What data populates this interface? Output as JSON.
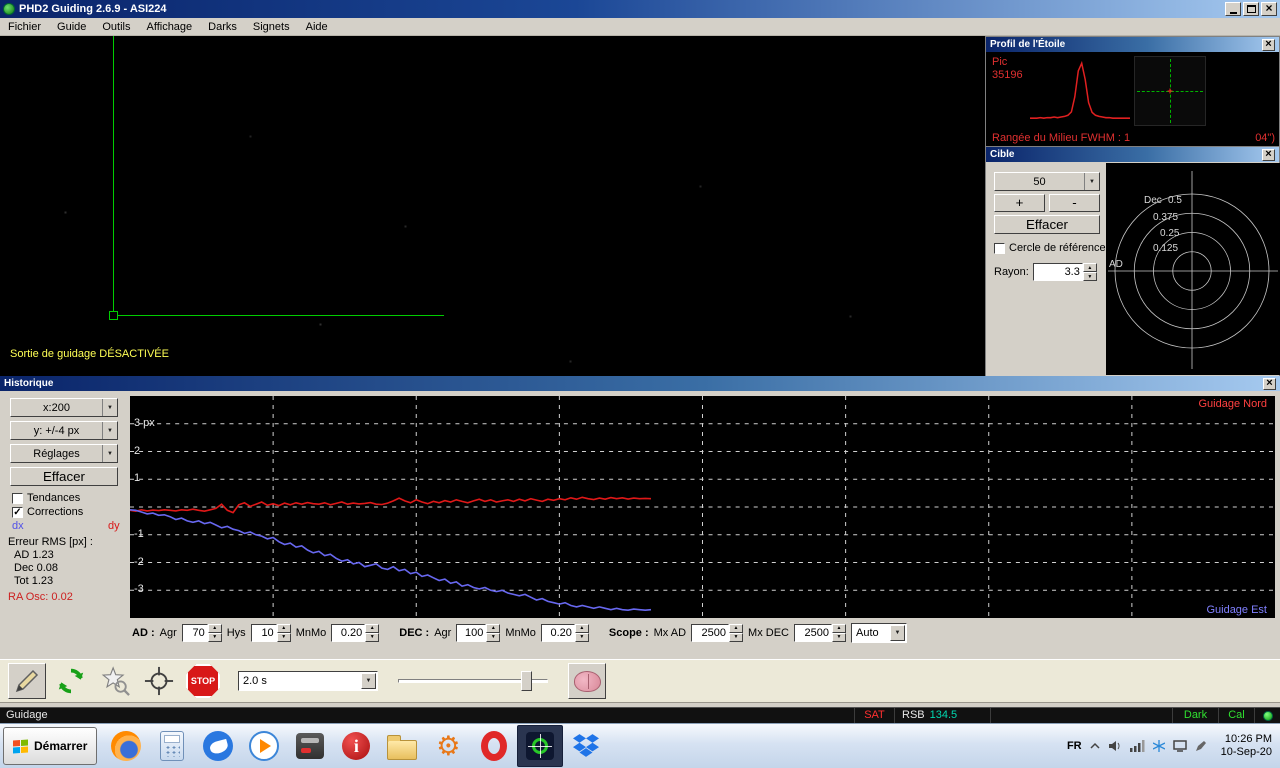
{
  "window": {
    "title": "PHD2 Guiding 2.6.9 - ASI224",
    "menus": [
      "Fichier",
      "Guide",
      "Outils",
      "Affichage",
      "Darks",
      "Signets",
      "Aide"
    ]
  },
  "camera": {
    "overlay_text": "Sortie de guidage DÉSACTIVÉE"
  },
  "star_profile": {
    "title": "Profil de l'Étoile",
    "peak_label": "Pic",
    "peak_value": "35196",
    "fwhm_left": "Rangée du Milieu FWHM : 1",
    "fwhm_right": "04\")"
  },
  "target": {
    "title": "Cible",
    "zoom_value": "50",
    "plus_label": "+",
    "minus_label": "-",
    "clear_label": "Effacer",
    "ref_circle_label": "Cercle de référence",
    "radius_label": "Rayon:",
    "radius_value": "3.3",
    "dec_axis_label": "Dec",
    "ad_axis_label": "AD",
    "ring_labels": [
      "0.5",
      "0.375",
      "0.25",
      "0.125"
    ]
  },
  "history": {
    "title": "Historique",
    "x_scale": "x:200",
    "y_scale": "y: +/-4 px",
    "settings_label": "Réglages",
    "clear_label": "Effacer",
    "trends_label": "Tendances",
    "corrections_label": "Corrections",
    "dx_label": "dx",
    "dy_label": "dy",
    "rms_title": "Erreur RMS [px] :",
    "rms_ad": "AD  1.23",
    "rms_dec": "Dec 0.08",
    "rms_tot": "Tot  1.23",
    "ra_osc": "RA Osc: 0.02",
    "legend_north": "Guidage Nord",
    "legend_east": "Guidage Est",
    "controls": {
      "ad_label": "AD :",
      "ad_agr_label": "Agr",
      "ad_agr_value": "70",
      "ad_hys_label": "Hys",
      "ad_hys_value": "10",
      "ad_mnmo_label": "MnMo",
      "ad_mnmo_value": "0.20",
      "dec_label": "DEC :",
      "dec_agr_label": "Agr",
      "dec_agr_value": "100",
      "dec_mnmo_label": "MnMo",
      "dec_mnmo_value": "0.20",
      "scope_label": "Scope :",
      "mx_ad_label": "Mx AD",
      "mx_ad_value": "2500",
      "mx_dec_label": "Mx DEC",
      "mx_dec_value": "2500",
      "dec_mode_value": "Auto"
    }
  },
  "chart_data": [
    {
      "id": "history-graph",
      "type": "line",
      "title": "Historique",
      "ylabel": "px",
      "ylim": [
        -4,
        4
      ],
      "x_capacity": 200,
      "x_visible": 92,
      "grid": true,
      "y_ticks": [
        {
          "v": 3,
          "label": "3 px"
        },
        {
          "v": 2,
          "label": "2"
        },
        {
          "v": 1,
          "label": "1"
        },
        {
          "v": -1,
          "label": "-1"
        },
        {
          "v": -2,
          "label": "-2"
        },
        {
          "v": -3,
          "label": "-3"
        }
      ],
      "legend": [
        {
          "label": "Guidage Nord",
          "color": "#ff4040",
          "position": "top-right"
        },
        {
          "label": "Guidage Est",
          "color": "#8080ff",
          "position": "bottom-right"
        }
      ],
      "series": [
        {
          "name": "dy",
          "color": "#e01818",
          "values": [
            -0.12,
            -0.15,
            -0.1,
            -0.14,
            -0.11,
            -0.13,
            -0.1,
            -0.12,
            -0.14,
            -0.1,
            -0.12,
            -0.08,
            -0.12,
            -0.15,
            -0.1,
            -0.05,
            0.1,
            -0.12,
            -0.2,
            0.08,
            0.15,
            0.02,
            0.1,
            0.18,
            0.06,
            0.12,
            0.05,
            0.14,
            0.08,
            0.15,
            0.1,
            0.16,
            0.12,
            0.1,
            0.15,
            0.08,
            0.13,
            0.18,
            0.1,
            0.14,
            0.11,
            0.13,
            0.16,
            0.1,
            0.09,
            0.14,
            0.22,
            0.32,
            0.22,
            0.15,
            0.26,
            0.18,
            0.12,
            0.2,
            0.15,
            0.23,
            0.18,
            0.26,
            0.2,
            0.15,
            0.22,
            0.28,
            0.2,
            0.26,
            0.18,
            0.22,
            0.26,
            0.2,
            0.28,
            0.22,
            0.3,
            0.25,
            0.2,
            0.28,
            0.24,
            0.3,
            0.26,
            0.33,
            0.28,
            0.35,
            0.3,
            0.27,
            0.32,
            0.28,
            0.34,
            0.3,
            0.33,
            0.29,
            0.32,
            0.3,
            0.31,
            0.3
          ]
        },
        {
          "name": "dx",
          "color": "#6868f0",
          "values": [
            -0.1,
            -0.12,
            -0.18,
            -0.25,
            -0.22,
            -0.3,
            -0.28,
            -0.35,
            -0.45,
            -0.4,
            -0.5,
            -0.55,
            -0.5,
            -0.6,
            -0.55,
            -0.65,
            -0.75,
            -0.7,
            -0.8,
            -0.85,
            -0.95,
            -0.9,
            -1.0,
            -1.05,
            -1.15,
            -1.1,
            -1.25,
            -1.35,
            -1.3,
            -1.45,
            -1.4,
            -1.55,
            -1.65,
            -1.6,
            -1.75,
            -1.7,
            -1.85,
            -1.95,
            -1.9,
            -2.05,
            -2.0,
            -2.15,
            -2.1,
            -2.05,
            -2.2,
            -2.25,
            -2.15,
            -2.3,
            -2.25,
            -2.4,
            -2.35,
            -2.5,
            -2.45,
            -2.55,
            -2.65,
            -2.6,
            -2.75,
            -2.7,
            -2.85,
            -2.8,
            -2.9,
            -2.95,
            -2.9,
            -3.0,
            -3.05,
            -3.0,
            -3.1,
            -3.15,
            -3.2,
            -3.15,
            -3.25,
            -3.35,
            -3.3,
            -3.4,
            -3.45,
            -3.5,
            -3.45,
            -3.55,
            -3.6,
            -3.55,
            -3.6,
            -3.65,
            -3.6,
            -3.65,
            -3.7,
            -3.65,
            -3.7,
            -3.72,
            -3.68,
            -3.7,
            -3.72,
            -3.7
          ]
        }
      ]
    },
    {
      "id": "star-profile",
      "type": "line",
      "title": "Profil de l'Étoile",
      "peak_value": 35196,
      "series": [
        {
          "name": "profile",
          "color": "#e02020",
          "values": [
            3,
            3,
            3,
            4,
            3,
            4,
            4,
            5,
            4,
            5,
            6,
            8,
            14,
            40,
            85,
            98,
            70,
            30,
            13,
            8,
            6,
            5,
            4,
            4,
            3,
            3,
            3,
            3,
            3,
            3
          ]
        }
      ]
    }
  ],
  "toolbar": {
    "exposure_value": "2.0 s",
    "stop_label": "STOP"
  },
  "statusbar": {
    "mode": "Guidage",
    "sat_label": "SAT",
    "rsb_label": "RSB",
    "rsb_value": "134.5",
    "dark_label": "Dark",
    "cal_label": "Cal"
  },
  "taskbar": {
    "start_label": "Démarrer",
    "language": "FR",
    "time": "10:26 PM",
    "date": "10-Sep-20"
  }
}
